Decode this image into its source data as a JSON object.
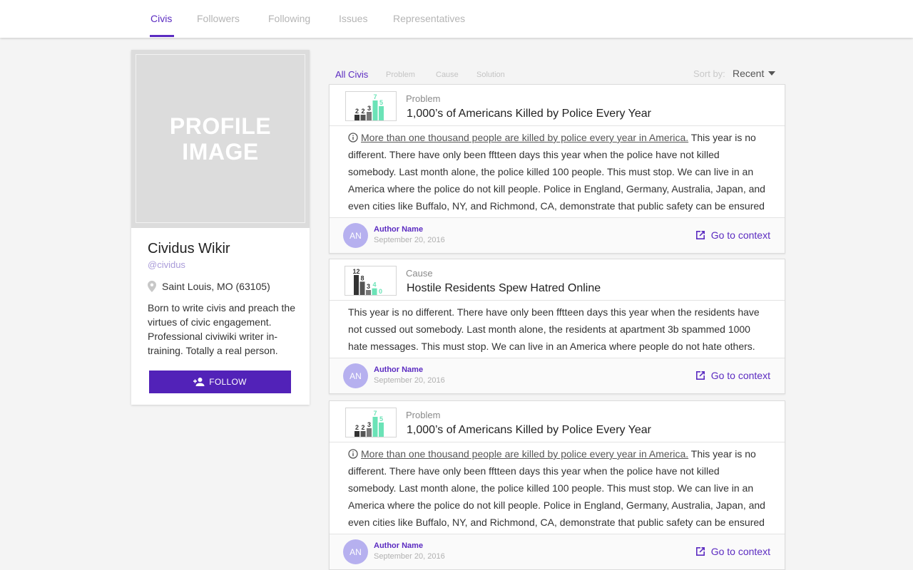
{
  "nav": {
    "tabs": [
      {
        "label": "Civis",
        "active": true
      },
      {
        "label": "Followers",
        "active": false
      },
      {
        "label": "Following",
        "active": false
      },
      {
        "label": "Issues",
        "active": false
      },
      {
        "label": "Representatives",
        "active": false
      }
    ]
  },
  "profile": {
    "image_placeholder": "PROFILE\nIMAGE",
    "name": "Cividus Wikir",
    "handle": "@cividus",
    "location": "Saint Louis, MO (63105)",
    "bio": "Born to write civis and preach the virtues of civic engagement. Professional civiwiki writer in-training. Totally a real person.",
    "follow_label": "FOLLOW"
  },
  "filters": {
    "items": [
      "All Civis",
      "Problem",
      "Cause",
      "Solution"
    ],
    "active": "All Civis",
    "sort_label": "Sort by:",
    "sort_value": "Recent"
  },
  "civis": [
    {
      "type": "Problem",
      "title": "1,000’s of Americans Killed by Police Every Year",
      "chart": {
        "values": [
          2,
          2,
          3,
          7,
          5
        ],
        "colors": [
          "#333333",
          "#555555",
          "#777777",
          "#6be3b7",
          "#6be3b7"
        ]
      },
      "link_text": "More than one thousand people are killed by police every year in America.",
      "body": "This year is no different. There have only been fftteen days this year when the police have not killed somebody. Last month alone, the police killed 100 people. This must stop. We can live in an America where the police do not kill people. Police in England, Germany, Australia, Japan, and even cities like Buffalo, NY, and Richmond, CA, demonstrate that public safety can be ensured",
      "author_initials": "AN",
      "author": "Author Name",
      "date": "September 20, 2016",
      "context_label": "Go to context"
    },
    {
      "type": "Cause",
      "title": "Hostile Residents Spew Hatred Online",
      "chart": {
        "values": [
          12,
          8,
          3,
          4,
          0
        ],
        "colors": [
          "#333333",
          "#555555",
          "#777777",
          "#6be3b7",
          "#6be3b7"
        ]
      },
      "link_text": "",
      "body": "This year is no different. There have only been fftteen days this year when the residents have not cussed out somebody. Last month alone, the residents at apartment 3b spammed 1000 hate messages. This must stop. We can live in an America where people do not hate others. By",
      "author_initials": "AN",
      "author": "Author Name",
      "date": "September 20, 2016",
      "context_label": "Go to context"
    },
    {
      "type": "Problem",
      "title": "1,000’s of Americans Killed by Police Every Year",
      "chart": {
        "values": [
          2,
          2,
          3,
          7,
          5
        ],
        "colors": [
          "#333333",
          "#555555",
          "#777777",
          "#6be3b7",
          "#6be3b7"
        ]
      },
      "link_text": "More than one thousand people are killed by police every year in America.",
      "body": "This year is no different. There have only been fftteen days this year when the police have not killed somebody. Last month alone, the police killed 100 people. This must stop. We can live in an America where the police do not kill people. Police in England, Germany, Australia, Japan, and even cities like Buffalo, NY, and Richmond, CA, demonstrate that public safety can be ensured",
      "author_initials": "AN",
      "author": "Author Name",
      "date": "September 20, 2016",
      "context_label": "Go to context"
    }
  ],
  "colors": {
    "accent": "#5b2bc1",
    "follow_button": "#5222b8",
    "avatar": "#b6b0ef",
    "positive": "#6be3b7"
  }
}
